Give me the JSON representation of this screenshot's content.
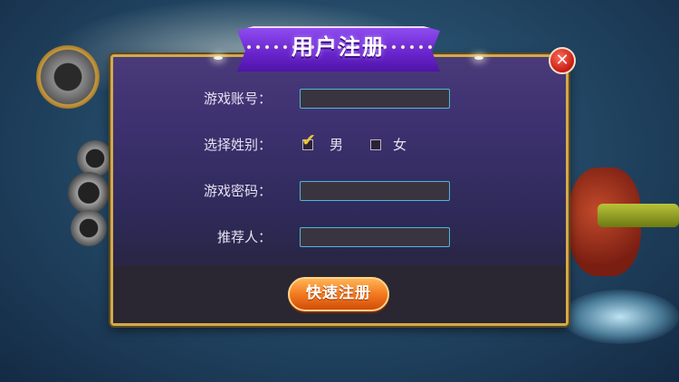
{
  "title": "用户注册",
  "close_symbol": "✕",
  "form": {
    "account_label": "游戏账号：",
    "account_value": "",
    "gender_label": "选择姓别：",
    "gender_options": [
      {
        "label": "男",
        "checked": true
      },
      {
        "label": "女",
        "checked": false
      }
    ],
    "password_label": "游戏密码：",
    "password_value": "",
    "referrer_label": "推荐人：",
    "referrer_value": ""
  },
  "submit_label": "快速注册",
  "colors": {
    "panel_border": "#d4a94a",
    "banner_purple": "#6a26cf",
    "field_border": "#4fb7d6",
    "button_orange": "#f27a1f",
    "close_red": "#c81a12",
    "checkmark": "#f3c53a"
  }
}
